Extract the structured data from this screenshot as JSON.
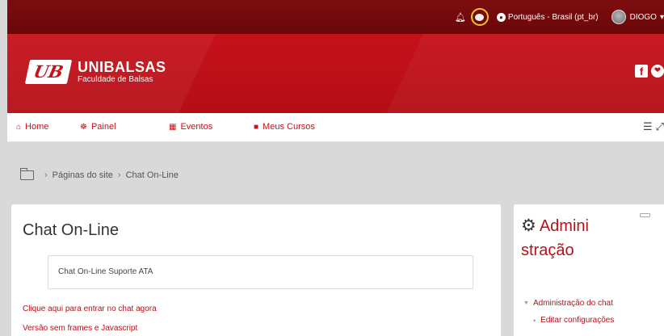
{
  "topbar": {
    "notifications_icon": "bell-icon",
    "messages_icon": "chat-bubble-icon",
    "language_label": "Português - Brasil (pt_br)",
    "user_name": "DIOGO",
    "user_caret": "▾",
    "colors": {
      "background": "#7d0d0f",
      "highlight_ring": "#f1c12a"
    }
  },
  "banner": {
    "logo_mark": "UB",
    "logo_name": "UNIBALSAS",
    "logo_subtitle": "Faculdade de Balsas",
    "social": {
      "facebook": "f",
      "other": "❤"
    },
    "colors": {
      "background": "#c6111b"
    }
  },
  "nav": {
    "items": [
      {
        "icon": "home-icon",
        "glyph": "⌂",
        "label": "Home"
      },
      {
        "icon": "dashboard-icon",
        "glyph": "☸",
        "label": "Painel"
      },
      {
        "icon": "calendar-icon",
        "glyph": "▦",
        "label": "Eventos"
      },
      {
        "icon": "briefcase-icon",
        "glyph": "■",
        "label": "Meus Cursos"
      }
    ],
    "right_icons": [
      "indent-icon",
      "expand-icon"
    ]
  },
  "breadcrumb": {
    "items": [
      "Páginas do site",
      "Chat On-Line"
    ]
  },
  "main": {
    "title": "Chat On-Line",
    "intro": "Chat On-Line Suporte ATA",
    "links": [
      "Clique aqui para entrar no chat agora",
      "Versão sem frames e Javascript"
    ]
  },
  "admin_block": {
    "title": "Administração",
    "title_line1": "Admini",
    "title_line2": "stração",
    "items": [
      {
        "label": "Administração do chat",
        "level": 0
      },
      {
        "label": "Editar configurações",
        "level": 1
      }
    ]
  }
}
